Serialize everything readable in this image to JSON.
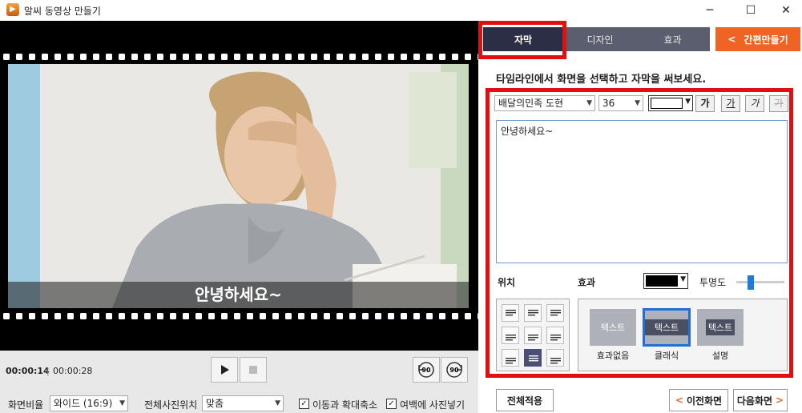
{
  "window": {
    "title": "알씨 동영상 만들기",
    "app_icon": "film-icon",
    "minimize": "─",
    "maximize": "☐",
    "close": "✕"
  },
  "preview": {
    "subtitle": "안녕하세요~"
  },
  "playback": {
    "current_time": "00:00:14",
    "separator": "|",
    "total_time": "00:00:28",
    "rotate_left_label": "90",
    "rotate_right_label": "90"
  },
  "bottom": {
    "ratio_label": "화면비율",
    "ratio_value": "와이드 (16:9)",
    "photo_position_label": "전체사진위치",
    "photo_position_value": "맞춤",
    "move_zoom_label": "이동과 확대축소",
    "move_zoom_checked": true,
    "margin_label": "여백에 사진넣기",
    "margin_checked": true
  },
  "tabs": [
    {
      "label": "자막",
      "active": true
    },
    {
      "label": "디자인",
      "active": false
    },
    {
      "label": "효과",
      "active": false
    }
  ],
  "quick_make": {
    "arrow": "<",
    "label": "간편만들기"
  },
  "subtitle_panel": {
    "instruction": "타임라인에서 화면을 선택하고 자막을 써보세요.",
    "font": "배달의민족 도현",
    "font_size": "36",
    "text_color": "#ffffff",
    "format_buttons": [
      "가",
      "가",
      "가",
      "가"
    ],
    "text": "안녕하세요~",
    "position_label": "위치",
    "effect_label": "효과",
    "effect_color": "#000000",
    "opacity_label": "투명도",
    "opacity": 0.3,
    "effects": [
      {
        "sample": "텍스트",
        "label": "효과없음",
        "selected": false
      },
      {
        "sample": "텍스트",
        "label": "클래식",
        "selected": true
      },
      {
        "sample": "텍스트",
        "label": "설명",
        "selected": false
      }
    ],
    "apply_all": "전체적용",
    "prev": "이전화면",
    "next": "다음화면"
  },
  "colors": {
    "accent": "#ef6424",
    "tab_active": "#2b2e45",
    "tab_inactive": "#5b5e6e",
    "highlight": "#e01010",
    "selected_effect": "#1f6fd6"
  }
}
